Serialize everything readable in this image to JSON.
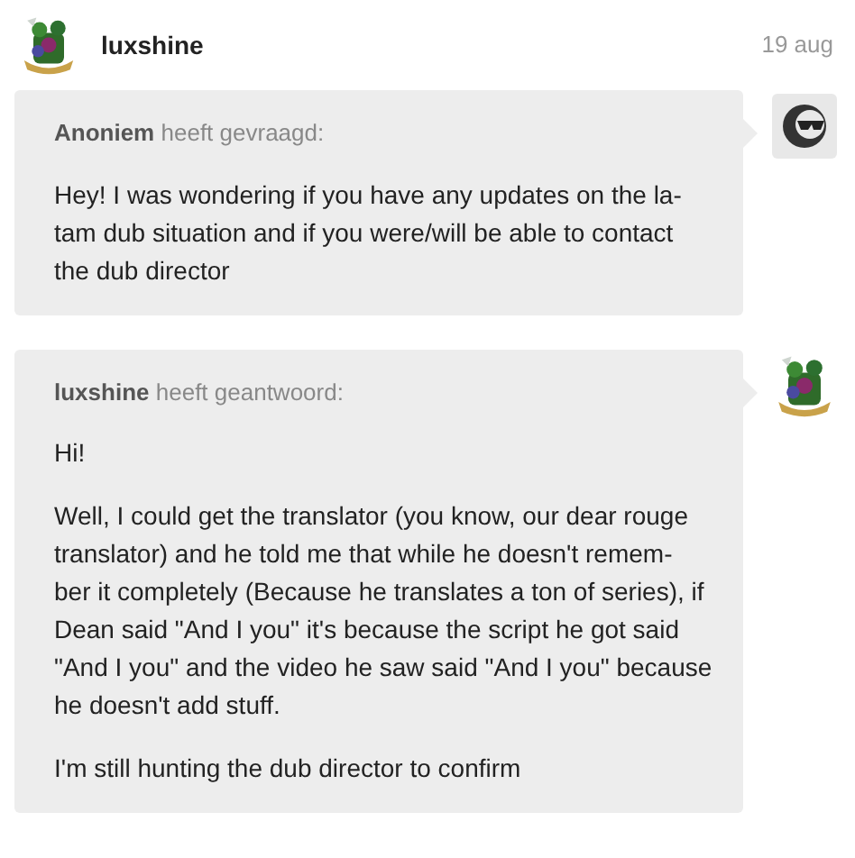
{
  "post": {
    "author": "luxshine",
    "date": "19 aug"
  },
  "messages": [
    {
      "kind": "ask",
      "name": "Anoniem",
      "verb": "heeft gevraagd:",
      "paragraphs": [
        [
          "Hey! I was wondering if you have any updates on the la-",
          "tam dub situation and if you were/will be able to contact",
          "the dub director"
        ]
      ]
    },
    {
      "kind": "answer",
      "name": "luxshine",
      "verb": "heeft geantwoord:",
      "paragraphs": [
        [
          "Hi!"
        ],
        [
          "Well, I could get the translator (you know, our dear rouge",
          "translator) and he told me that while he doesn't remem-",
          "ber it completely (Because he translates a ton of series), if",
          "Dean said \"And I you\" it's because the script he got said",
          "\"And I you\" and the video he saw said \"And I you\" because",
          "he doesn't add stuff."
        ],
        [
          "I'm still hunting the dub director to confirm"
        ]
      ]
    }
  ]
}
